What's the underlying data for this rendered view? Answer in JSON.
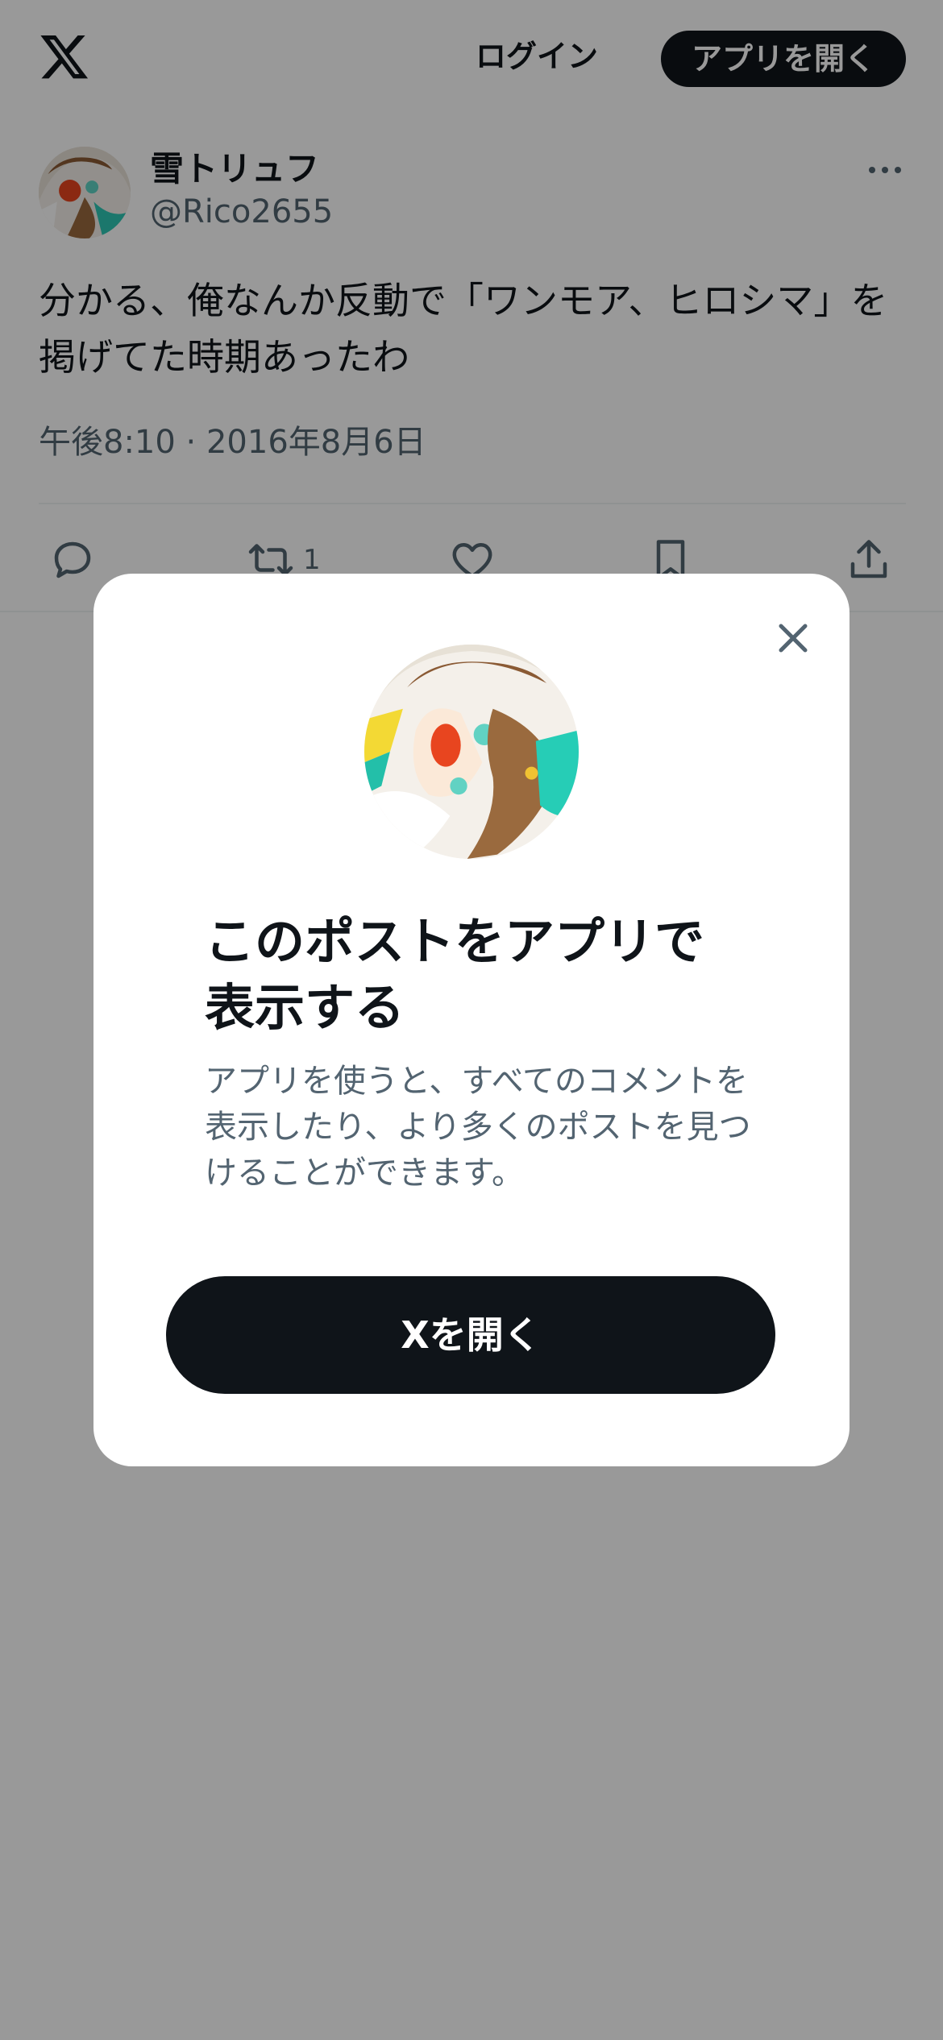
{
  "header": {
    "logo_icon": "x-logo-icon",
    "login_label": "ログイン",
    "open_app_label": "アプリを開く"
  },
  "tweet": {
    "author": {
      "display_name": "雪トリュフ",
      "handle": "@Rico2655",
      "avatar_icon": "user-avatar"
    },
    "text": "分かる、俺なんか反動で「ワンモア、ヒロシマ」を掲げてた時期あったわ",
    "timestamp": "午後8:10 · 2016年8月6日",
    "more_icon": "more-horizontal-icon",
    "actions": {
      "reply_icon": "reply-icon",
      "retweet_icon": "retweet-icon",
      "retweet_count": "1",
      "like_icon": "heart-icon",
      "bookmark_icon": "bookmark-icon",
      "share_icon": "share-icon"
    }
  },
  "modal": {
    "close_icon": "close-icon",
    "title": "このポストをアプリで表示する",
    "description": "アプリを使うと、すべてのコメントを表示したり、より多くのポストを見つけることができます。",
    "cta_label": "Xを開く"
  },
  "colors": {
    "primary_text": "#0f1419",
    "secondary_text": "#536471",
    "button_dark": "#0f1419",
    "overlay": "rgba(0,0,0,0.4)"
  }
}
